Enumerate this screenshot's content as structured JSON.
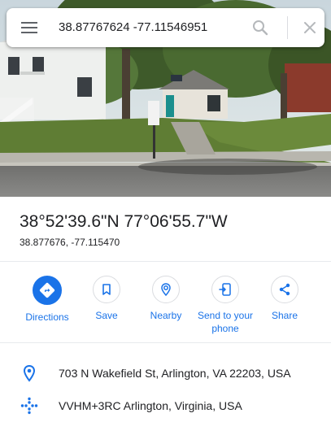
{
  "search": {
    "query": "38.87767624 -77.11546951",
    "menu_icon": "hamburger-menu-icon",
    "search_icon": "search-icon",
    "close_icon": "close-icon"
  },
  "place": {
    "title": "38°52'39.6\"N 77°06'55.7\"W",
    "decimal": "38.877676, -77.115470"
  },
  "actions": [
    {
      "label": "Directions",
      "icon": "directions-icon"
    },
    {
      "label": "Save",
      "icon": "bookmark-icon"
    },
    {
      "label": "Nearby",
      "icon": "nearby-icon"
    },
    {
      "label_line1": "Send to your",
      "label_line2": "phone",
      "icon": "send-to-phone-icon"
    },
    {
      "label": "Share",
      "icon": "share-icon"
    }
  ],
  "info": {
    "address": "703 N Wakefield St, Arlington, VA 22203, USA",
    "plus_code": "VVHM+3RC Arlington, Virginia, USA"
  },
  "colors": {
    "accent": "#1a73e8",
    "text": "#202124",
    "icon_gray": "#5f6368"
  }
}
